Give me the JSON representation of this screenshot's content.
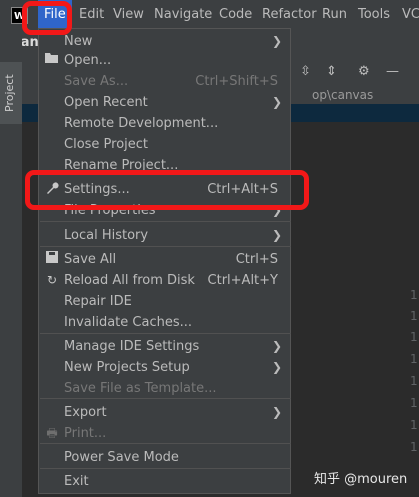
{
  "menubar": {
    "logo": "W",
    "items": [
      "File",
      "Edit",
      "View",
      "Navigate",
      "Code",
      "Refactor",
      "Run",
      "Tools",
      "VC"
    ]
  },
  "side": {
    "project_label": "Project",
    "breadcrumb": "canv"
  },
  "path": "op\\canvas",
  "line_numbers": [
    "1",
    "1",
    "1",
    "1",
    "1",
    "1",
    "1",
    "1"
  ],
  "file_menu": {
    "items": [
      {
        "label": "New",
        "submenu": true
      },
      {
        "label": "Open...",
        "icon": "folder-open-icon"
      },
      {
        "label": "Save As...",
        "shortcut": "Ctrl+Shift+S",
        "disabled": true
      },
      {
        "label": "Open Recent",
        "submenu": true
      },
      {
        "label": "Remote Development..."
      },
      {
        "label": "Close Project"
      },
      {
        "label": "Rename Project..."
      },
      {
        "label": "Settings...",
        "shortcut": "Ctrl+Alt+S",
        "icon": "wrench-icon"
      },
      {
        "label": "File Properties",
        "submenu": true
      },
      {
        "label": "Local History",
        "submenu": true
      },
      {
        "label": "Save All",
        "shortcut": "Ctrl+S",
        "icon": "save-icon"
      },
      {
        "label": "Reload All from Disk",
        "shortcut": "Ctrl+Alt+Y",
        "icon": "reload-icon"
      },
      {
        "label": "Repair IDE"
      },
      {
        "label": "Invalidate Caches..."
      },
      {
        "label": "Manage IDE Settings",
        "submenu": true
      },
      {
        "label": "New Projects Setup",
        "submenu": true
      },
      {
        "label": "Save File as Template...",
        "disabled": true
      },
      {
        "label": "Export",
        "submenu": true
      },
      {
        "label": "Print...",
        "disabled": true,
        "icon": "print-icon"
      },
      {
        "label": "Power Save Mode"
      },
      {
        "label": "Exit"
      }
    ]
  },
  "watermark": "知乎 @mouren",
  "colors": {
    "highlight": "#f21818",
    "menu_active": "#2f65ca",
    "menu_bg": "#3c3f41"
  }
}
